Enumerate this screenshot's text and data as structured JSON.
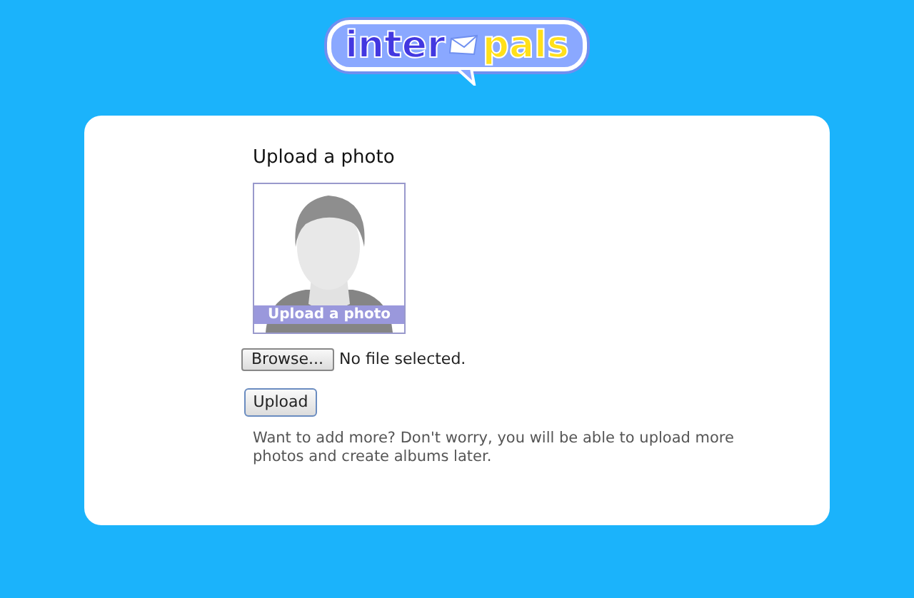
{
  "logo": {
    "left": "inter",
    "right": "pals"
  },
  "upload": {
    "title": "Upload a photo",
    "photo_label": "Upload a photo",
    "browse_button": "Browse...",
    "file_status": "No file selected.",
    "upload_button": "Upload",
    "note": "Want to add more? Don't worry, you will be able to upload more photos and create albums later."
  }
}
